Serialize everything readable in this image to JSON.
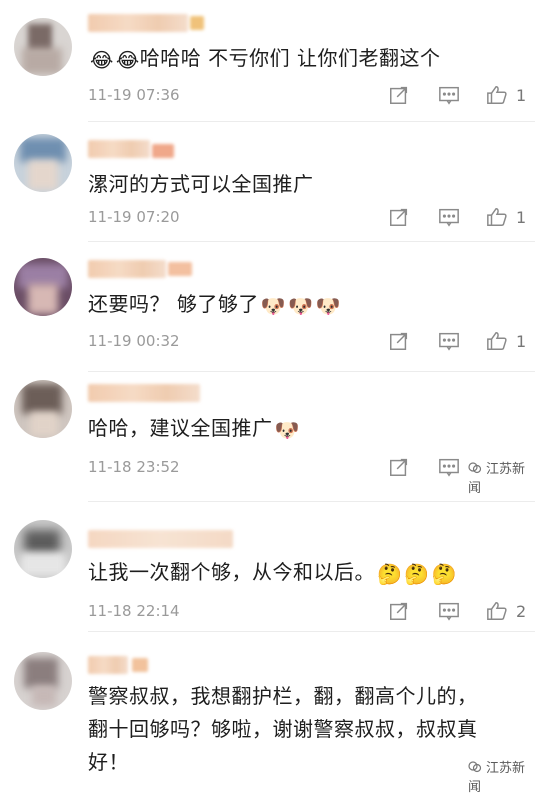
{
  "comments": [
    {
      "text": "哈哈哈  不亏你们 让你们老翻这个",
      "lead_emojis": [
        "😂",
        "😂"
      ],
      "trail_emojis": [],
      "time": "11-19 07:36",
      "likes": "1"
    },
    {
      "text": "漯河的方式可以全国推广",
      "lead_emojis": [],
      "trail_emojis": [],
      "time": "11-19 07:20",
      "likes": "1"
    },
    {
      "text": "还要吗？ 够了够了",
      "lead_emojis": [],
      "trail_emojis": [
        "🐶",
        "🐶",
        "🐶"
      ],
      "time": "11-19 00:32",
      "likes": "1"
    },
    {
      "text": "哈哈，建议全国推广",
      "lead_emojis": [],
      "trail_emojis": [
        "🐶"
      ],
      "time": "11-18 23:52",
      "likes": ""
    },
    {
      "text": "让我一次翻个够，从今和以后。",
      "lead_emojis": [],
      "trail_emojis": [
        "🤔",
        "🤔",
        "🤔"
      ],
      "time": "11-18 22:14",
      "likes": "2"
    },
    {
      "text_lines": [
        "警察叔叔，我想翻护栏，翻，翻高个儿的，",
        "翻十回够吗？够啦，谢谢警察叔叔，叔叔真",
        "好！"
      ],
      "lead_emojis": [],
      "trail_emojis": []
    }
  ],
  "watermarks": [
    "江苏新闻",
    "江苏新闻"
  ],
  "icons": {
    "forward": "share-icon",
    "reply": "comment-icon",
    "like": "thumbs-up-icon"
  },
  "colors": {
    "meta_gray": "#9a9a9a",
    "text": "#1e1e1e",
    "divider": "#ececec"
  }
}
